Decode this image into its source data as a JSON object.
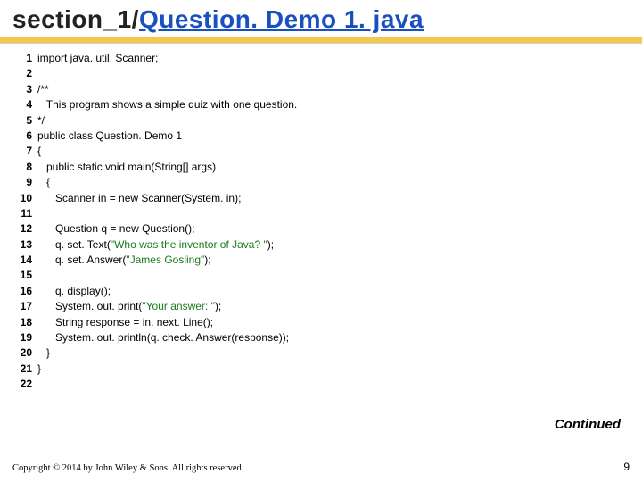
{
  "title": {
    "prefix": "section_1/",
    "link": "Question. Demo 1. java"
  },
  "code": {
    "lines": [
      {
        "n": "1",
        "text": "import java. util. Scanner;"
      },
      {
        "n": "2",
        "text": ""
      },
      {
        "n": "3",
        "text": "/**"
      },
      {
        "n": "4",
        "text": "   This program shows a simple quiz with one question."
      },
      {
        "n": "5",
        "text": "*/"
      },
      {
        "n": "6",
        "text": "public class Question. Demo 1"
      },
      {
        "n": "7",
        "text": "{"
      },
      {
        "n": "8",
        "text": "   public static void main(String[] args)"
      },
      {
        "n": "9",
        "text": "   {"
      },
      {
        "n": "10",
        "text": "      Scanner in = new Scanner(System. in);"
      },
      {
        "n": "11",
        "text": ""
      },
      {
        "n": "12",
        "text": "      Question q = new Question();"
      },
      {
        "n": "13",
        "text": "      q. set. Text(\"Who was the inventor of Java? \");",
        "str_start": 19
      },
      {
        "n": "14",
        "text": "      q. set. Answer(\"James Gosling\");",
        "str_start": 21
      },
      {
        "n": "15",
        "text": ""
      },
      {
        "n": "16",
        "text": "      q. display();"
      },
      {
        "n": "17",
        "text": "      System. out. print(\"Your answer: \");",
        "str_start": 25
      },
      {
        "n": "18",
        "text": "      String response = in. next. Line();"
      },
      {
        "n": "19",
        "text": "      System. out. println(q. check. Answer(response));"
      },
      {
        "n": "20",
        "text": "   }"
      },
      {
        "n": "21",
        "text": "}"
      },
      {
        "n": "22",
        "text": ""
      }
    ]
  },
  "continued": "Continued",
  "footer": {
    "copyright": "Copyright © 2014 by John Wiley & Sons. All rights reserved.",
    "page": "9"
  }
}
